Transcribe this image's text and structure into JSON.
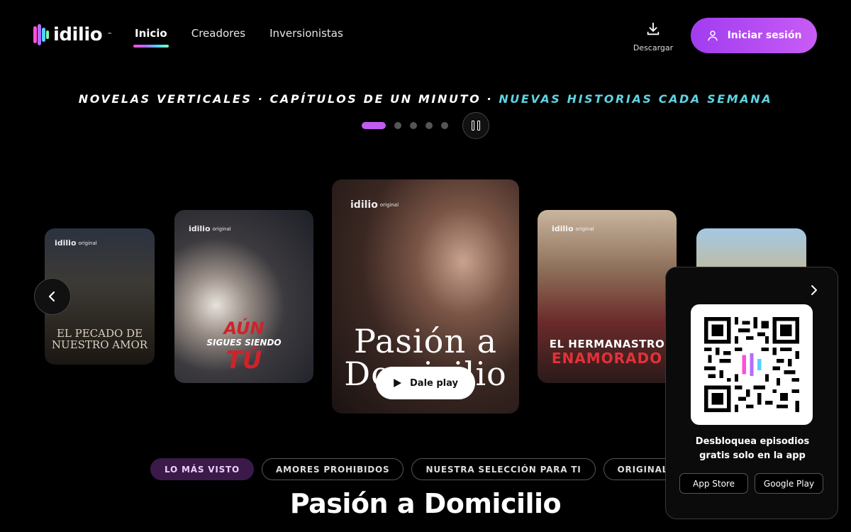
{
  "header": {
    "logo_text": "idilio",
    "logo_tm": "™",
    "nav": [
      {
        "label": "Inicio",
        "active": true
      },
      {
        "label": "Creadores",
        "active": false
      },
      {
        "label": "Inversionistas",
        "active": false
      }
    ],
    "download_label": "Descargar",
    "login_label": "Iniciar sesión"
  },
  "tagline": {
    "part1": "NOVELAS VERTICALES · CAPÍTULOS DE UN MINUTO · ",
    "highlight": "NUEVAS HISTORIAS CADA SEMANA"
  },
  "carousel": {
    "slide_count": 5,
    "active_slide": 1,
    "cards": [
      {
        "brand": "idilio",
        "brand_sub": "original",
        "title": "EL PECADO DE NUESTRO AMOR"
      },
      {
        "brand": "idilio",
        "brand_sub": "original",
        "title_line1": "AÚN",
        "title_line2": "SIGUES SIENDO",
        "title_line3": "TÚ"
      },
      {
        "brand": "idilio",
        "brand_sub": "original",
        "title": "Pasión a Domicilio",
        "play_label": "Dale play"
      },
      {
        "brand": "idilio",
        "brand_sub": "original",
        "title_line1": "EL HERMANASTRO",
        "title_line2": "ENAMORADO"
      },
      {
        "brand": "",
        "title": ""
      }
    ]
  },
  "categories": [
    {
      "label": "LO MÁS VISTO",
      "active": true
    },
    {
      "label": "AMORES PROHIBIDOS",
      "active": false
    },
    {
      "label": "NUESTRA SELECCIÓN PARA TI",
      "active": false
    },
    {
      "label": "ORIGINALES DE IDILIO",
      "active": false
    }
  ],
  "featured_title": "Pasión a Domicilio",
  "qr_panel": {
    "text": "Desbloquea episodios gratis solo en la app",
    "app_store": "App Store",
    "google_play": "Google Play"
  },
  "colors": {
    "accent": "#c15cf0",
    "tagline_highlight": "#5fd4e3",
    "background": "#000000"
  }
}
